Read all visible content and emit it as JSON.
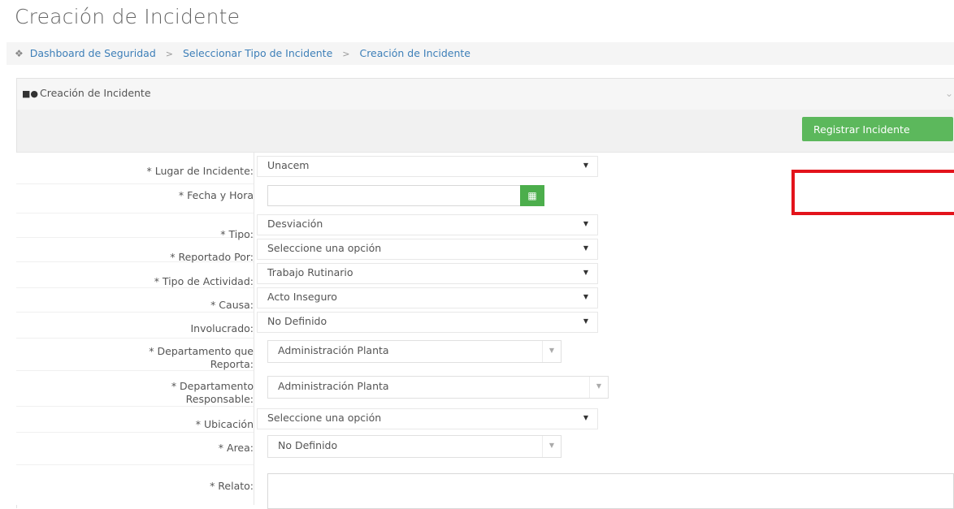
{
  "page": {
    "title": "Creación de Incidente"
  },
  "breadcrumb": {
    "items": [
      "Dashboard de Seguridad",
      "Seleccionar Tipo de Incidente",
      "Creación de Incidente"
    ],
    "separator": ">"
  },
  "panel": {
    "title": "Creación de Incidente"
  },
  "toolbar": {
    "register_label": "Registrar Incidente"
  },
  "form": {
    "lugar": {
      "label": "* Lugar de Incidente:",
      "value": "Unacem"
    },
    "fecha": {
      "label": "* Fecha y Hora",
      "value": ""
    },
    "tipo": {
      "label": "* Tipo:",
      "value": "Desviación"
    },
    "reportado": {
      "label": "* Reportado Por:",
      "value": "Seleccione una opción"
    },
    "actividad": {
      "label": "* Tipo de Actividad:",
      "value": "Trabajo Rutinario"
    },
    "causa": {
      "label": "* Causa:",
      "value": "Acto Inseguro"
    },
    "involucrado": {
      "label": "Involucrado:",
      "value": "No Definido"
    },
    "depto_reporta": {
      "label_1": "* Departamento que",
      "label_2": "Reporta:",
      "value": "Administración Planta"
    },
    "depto_resp": {
      "label_1": "* Departamento",
      "label_2": "Responsable:",
      "value": "Administración Planta"
    },
    "ubicacion": {
      "label": "* Ubicación",
      "value": "Seleccione una opción"
    },
    "area": {
      "label": "* Area:",
      "value": "No Definido"
    },
    "relato": {
      "label": "* Relato:",
      "value": ""
    }
  },
  "colors": {
    "accent_green": "#5cb85c",
    "link_blue": "#3d7fb8",
    "highlight_red": "#e3131b"
  }
}
